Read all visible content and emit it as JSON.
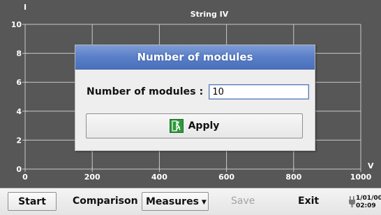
{
  "chart": {
    "title": "String IV",
    "x_label": "V",
    "y_label": "I",
    "x_ticks": [
      "0",
      "200",
      "400",
      "600",
      "800",
      "1000"
    ],
    "y_ticks": [
      "0",
      "2",
      "4",
      "6",
      "8",
      "10"
    ],
    "background": "#575757",
    "grid_color": "#c8c8c8"
  },
  "chart_data": {
    "type": "line",
    "title": "String IV",
    "xlabel": "V",
    "ylabel": "I",
    "xlim": [
      0,
      1000
    ],
    "ylim": [
      0,
      10
    ],
    "grid": true,
    "series": []
  },
  "dialog": {
    "title": "Number of modules",
    "field_label": "Number of modules :",
    "field_value": "10",
    "apply_label": "Apply"
  },
  "toolbar": {
    "start": "Start",
    "comparison": "Comparison",
    "measures": "Measures",
    "save": "Save",
    "exit": "Exit"
  },
  "status": {
    "date": "1/01/00",
    "time": "02:09"
  },
  "icons": {
    "apply": "exit-running-man-icon",
    "plug": "power-plug-icon",
    "dropdown": "caret-down-icon"
  }
}
